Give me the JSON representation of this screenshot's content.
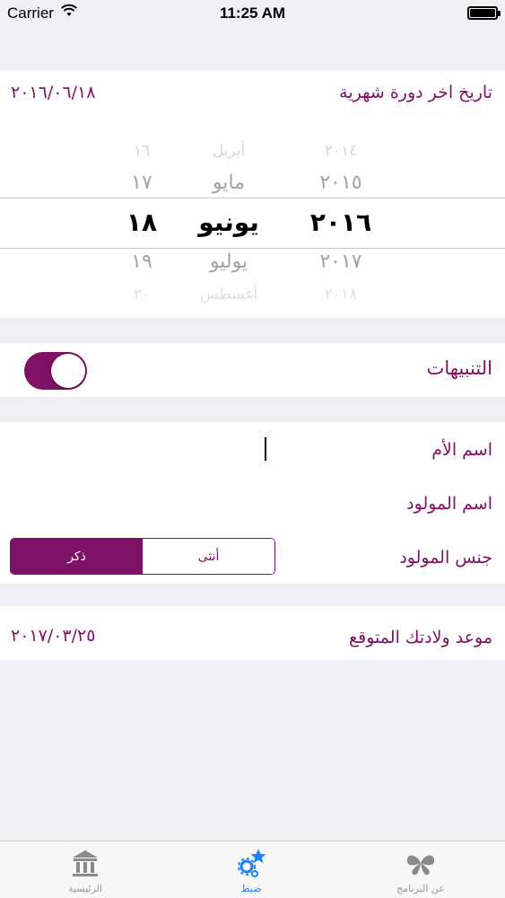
{
  "status_bar": {
    "carrier": "Carrier",
    "time": "11:25 AM"
  },
  "colors": {
    "accent": "#7e1065",
    "tab_active": "#1a82fb",
    "tab_inactive": "#9a9a9a"
  },
  "last_period": {
    "label": "تاريخ اخر دورة شهرية",
    "value": "٢٠١٦/٠٦/١٨",
    "picker": {
      "days": [
        "١٦",
        "١٧",
        "١٨",
        "١٩",
        "٢٠"
      ],
      "months": [
        "أبريل",
        "مايو",
        "يونيو",
        "يوليو",
        "أغسطس"
      ],
      "years": [
        "٢٠١٤",
        "٢٠١٥",
        "٢٠١٦",
        "٢٠١٧",
        "٢٠١٨"
      ],
      "selected": {
        "day": "١٨",
        "month": "يونيو",
        "year": "٢٠١٦"
      }
    }
  },
  "notifications": {
    "label": "التنبيهات",
    "enabled": true
  },
  "form": {
    "mother_name_label": "اسم الأم",
    "mother_name_value": "",
    "baby_name_label": "اسم المولود",
    "baby_name_value": "",
    "gender_label": "جنس المولود",
    "gender_options": [
      "أنثى",
      "ذكر"
    ],
    "gender_selected": "ذكر"
  },
  "due_date": {
    "label": "موعد ولادتك المتوقع",
    "value": "٢٠١٧/٠٣/٢٥"
  },
  "tab_bar": {
    "tabs": [
      {
        "label": "الرئيسية",
        "icon": "bank-icon",
        "active": false
      },
      {
        "label": "ضبط",
        "icon": "settings-star-icon",
        "active": true
      },
      {
        "label": "عن البرنامج",
        "icon": "butterfly-icon",
        "active": false
      }
    ]
  }
}
